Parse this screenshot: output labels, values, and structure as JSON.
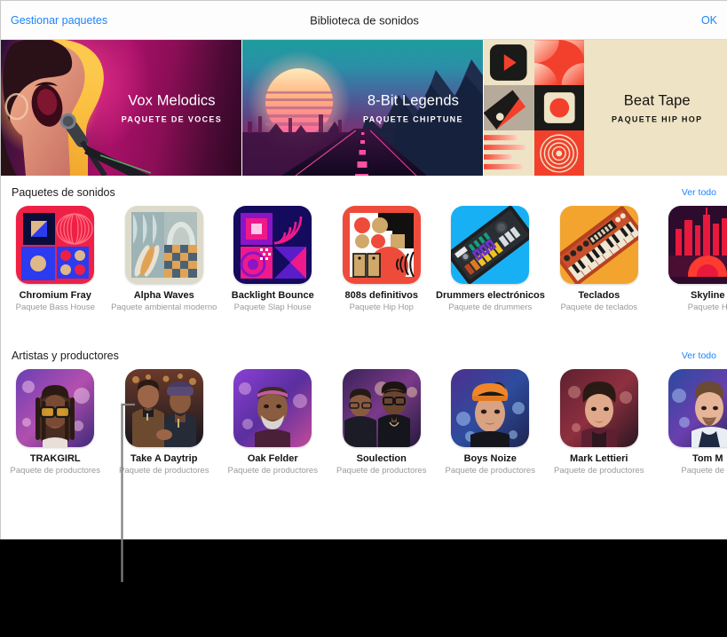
{
  "navbar": {
    "left_label": "Gestionar paquetes",
    "title": "Biblioteca de sonidos",
    "right_label": "OK"
  },
  "heroes": [
    {
      "title": "Vox Melodics",
      "subtitle": "PAQUETE DE VOCES",
      "art": "singer-artwork"
    },
    {
      "title": "8-Bit Legends",
      "subtitle": "PAQUETE CHIPTUNE",
      "art": "synthwave-artwork"
    },
    {
      "title": "Beat Tape",
      "subtitle": "PAQUETE HIP HOP",
      "art": "beat-tape-artwork"
    }
  ],
  "sections": [
    {
      "title": "Paquetes de sonidos",
      "see_all": "Ver todo",
      "items": [
        {
          "name": "Chromium Fray",
          "sub": "Paquete Bass House",
          "art": "chromium-fray-artwork"
        },
        {
          "name": "Alpha Waves",
          "sub": "Paquete ambiental moderno",
          "art": "alpha-waves-artwork"
        },
        {
          "name": "Backlight Bounce",
          "sub": "Paquete Slap House",
          "art": "backlight-bounce-artwork"
        },
        {
          "name": "808s definitivos",
          "sub": "Paquete Hip Hop",
          "art": "808s-artwork"
        },
        {
          "name": "Drummers electrónicos",
          "sub": "Paquete de drummers",
          "art": "drum-machine-artwork"
        },
        {
          "name": "Teclados",
          "sub": "Paquete de teclados",
          "art": "keyboard-artwork"
        },
        {
          "name": "Skyline",
          "sub": "Paquete H",
          "art": "skyline-artwork"
        }
      ]
    },
    {
      "title": "Artistas y productores",
      "see_all": "Ver todo",
      "items": [
        {
          "name": "TRAKGIRL",
          "sub": "Paquete de productores",
          "art": "trakgirl-portrait"
        },
        {
          "name": "Take A Daytrip",
          "sub": "Paquete de productores",
          "art": "take-a-daytrip-portrait"
        },
        {
          "name": "Oak Felder",
          "sub": "Paquete de productores",
          "art": "oak-felder-portrait"
        },
        {
          "name": "Soulection",
          "sub": "Paquete de productores",
          "art": "soulection-portrait"
        },
        {
          "name": "Boys Noize",
          "sub": "Paquete de productores",
          "art": "boys-noize-portrait"
        },
        {
          "name": "Mark Lettieri",
          "sub": "Paquete de productores",
          "art": "mark-lettieri-portrait"
        },
        {
          "name": "Tom M",
          "sub": "Paquete de pr",
          "art": "tom-misch-portrait"
        }
      ]
    }
  ],
  "colors": {
    "accent_blue": "#1b84ff",
    "sheet_background": "#ffffff",
    "page_background": "#000000",
    "callout_line": "#808080",
    "primary_text": "#141414",
    "secondary_text": "#9a9a9a"
  }
}
